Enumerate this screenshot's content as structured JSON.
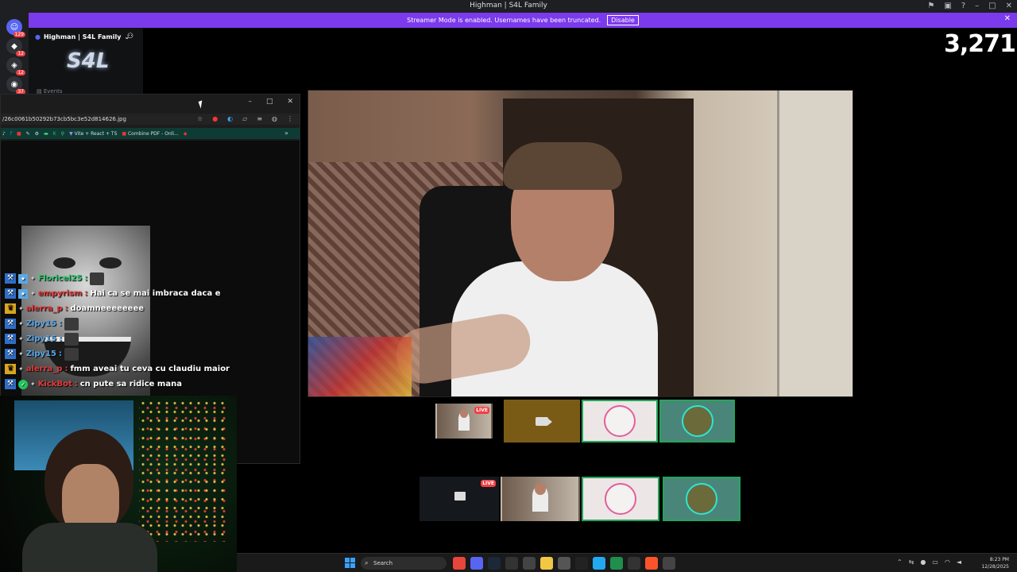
{
  "window": {
    "title": "Highman | S4L Family"
  },
  "streamer_mode": {
    "message": "Streamer Mode is enabled. Usernames have been truncated.",
    "disable_label": "Disable"
  },
  "server_rail": {
    "badges": [
      "129",
      "12",
      "12",
      "37"
    ]
  },
  "channel_panel": {
    "server_name": "Highman | S4L Family",
    "logo_text": "S4L",
    "events_label": "Events"
  },
  "viewer_count": "3,271",
  "browser": {
    "url": "/26c0061b50292b73cb5bc3e52d814626.jpg",
    "bookmarks": [
      "Vite + React + TS",
      "Combine PDF - Onli..."
    ]
  },
  "chat": [
    {
      "badges": [
        "mod",
        "sm"
      ],
      "user": "Floricel25",
      "user_color": "#2ecc71",
      "message": "",
      "emote": true
    },
    {
      "badges": [
        "mod",
        "sm"
      ],
      "user": "empyrism",
      "user_color": "#e23a3a",
      "message": "Hai ca se mai imbraca daca e",
      "emote": false
    },
    {
      "badges": [
        "crown"
      ],
      "user": "alerra_p",
      "user_color": "#e23a3a",
      "message": "doamneeeeeeee",
      "emote": false
    },
    {
      "badges": [
        "mod"
      ],
      "user": "Zipy15",
      "user_color": "#5aa7e8",
      "message": "",
      "emote": true
    },
    {
      "badges": [
        "mod"
      ],
      "user": "Zipy15",
      "user_color": "#5aa7e8",
      "message": "",
      "emote": true
    },
    {
      "badges": [
        "mod"
      ],
      "user": "Zipy15",
      "user_color": "#5aa7e8",
      "message": "",
      "emote": true
    },
    {
      "badges": [
        "crown"
      ],
      "user": "alerra_p",
      "user_color": "#e23a3a",
      "message": "fmm aveai tu ceva cu claudiu maior",
      "emote": false
    },
    {
      "badges": [
        "mod",
        "check"
      ],
      "user": "KickBot",
      "user_color": "#e23a3a",
      "message": "cn pute sa ridice mana",
      "emote": false
    }
  ],
  "tiles_row1": [
    {
      "kind": "camera",
      "live": "LIVE",
      "speaking": false
    },
    {
      "kind": "video-off",
      "speaking": false
    },
    {
      "kind": "avatar-pink",
      "speaking": true
    },
    {
      "kind": "avatar-teal",
      "speaking": true
    }
  ],
  "tiles_row2": [
    {
      "kind": "screen",
      "live": "LIVE",
      "speaking": false
    },
    {
      "kind": "camera",
      "speaking": false
    },
    {
      "kind": "avatar-pink",
      "speaking": true
    },
    {
      "kind": "avatar-teal",
      "speaking": true
    }
  ],
  "taskbar": {
    "search_placeholder": "Search",
    "time": "8:23 PM",
    "date": "12/28/2025",
    "apps": [
      {
        "icon": "chrome-icon",
        "color": "#e8453c"
      },
      {
        "icon": "discord-icon",
        "color": "#5865f2"
      },
      {
        "icon": "steam-icon",
        "color": "#1b2838"
      },
      {
        "icon": "capcut-icon",
        "color": "#333"
      },
      {
        "icon": "app-icon",
        "color": "#444"
      },
      {
        "icon": "folder-icon",
        "color": "#f2c744"
      },
      {
        "icon": "app-icon",
        "color": "#555"
      },
      {
        "icon": "app-icon",
        "color": "#222"
      },
      {
        "icon": "vscode-icon",
        "color": "#23a9f2"
      },
      {
        "icon": "excel-icon",
        "color": "#1f8f4b"
      },
      {
        "icon": "app-icon",
        "color": "#333"
      },
      {
        "icon": "brave-icon",
        "color": "#fb542b"
      },
      {
        "icon": "app-icon",
        "color": "#444"
      }
    ]
  }
}
